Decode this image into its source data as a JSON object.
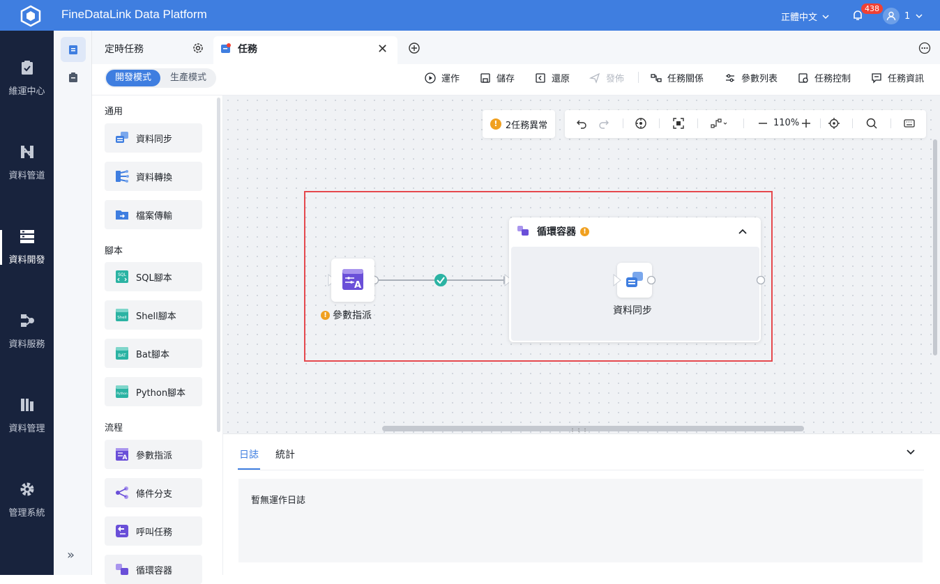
{
  "header": {
    "brand": "FineDataLink Data Platform",
    "language": "正體中文",
    "notification_count": "438",
    "user_name": "1"
  },
  "left_nav": {
    "items": [
      {
        "label": "維運中心",
        "icon": "clipboard-check-icon"
      },
      {
        "label": "資料管道",
        "icon": "pipeline-icon"
      },
      {
        "label": "資料開發",
        "icon": "data-dev-icon"
      },
      {
        "label": "資料服務",
        "icon": "data-service-icon"
      },
      {
        "label": "資料管理",
        "icon": "data-manage-icon"
      },
      {
        "label": "管理系統",
        "icon": "gear-icon"
      }
    ],
    "active": "資料開發"
  },
  "tabs": {
    "scheduled": "定時任務",
    "task": "任務"
  },
  "toolbar": {
    "mode_dev": "開發模式",
    "mode_prod": "生產模式",
    "run": "運作",
    "save": "儲存",
    "restore": "還原",
    "publish": "發佈",
    "relations": "任務關係",
    "params": "參數列表",
    "control": "任務控制",
    "info": "任務資訊"
  },
  "panel": {
    "sections": {
      "general": "通用",
      "script": "腳本",
      "flow": "流程"
    },
    "general": [
      "資料同步",
      "資料轉換",
      "檔案傳輸"
    ],
    "script": [
      "SQL腳本",
      "Shell腳本",
      "Bat腳本",
      "Python腳本"
    ],
    "flow": [
      "參數指派",
      "條件分支",
      "呼叫任務",
      "循環容器"
    ]
  },
  "canvas": {
    "alert": "2任務異常",
    "zoom": "110%",
    "nodes": {
      "assign": "參數指派",
      "loop_title": "循環容器",
      "sync": "資料同步"
    }
  },
  "log": {
    "tab_log": "日誌",
    "tab_stats": "統計",
    "empty": "暫無運作日誌"
  },
  "colors": {
    "primary": "#3f7ee0",
    "nav_bg": "#18233d",
    "warning": "#f0a020",
    "success": "#2bb3a3",
    "highlight_border": "#e5484d"
  }
}
